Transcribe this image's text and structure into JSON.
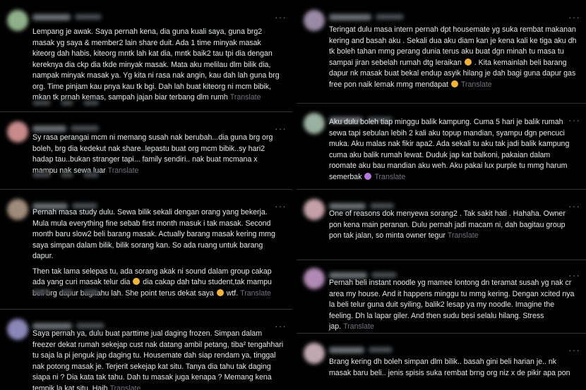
{
  "left_column": [
    {
      "avatar_color": "#8fb08a",
      "text": "Lempang je awak. Saya pernah kena, dia guna kuali saya, guna brg2 masak yg saya & member2 lain share duit. Ada 1 time minyak masak kiteorg dah habis, kiteorg mntk lah kat dia, mntk baik2 tau tpi dia dengan kereknya dia ckp dia tkde minyak masak. Mata aku melilau dlm bilik dia, nampak minyak masak ya. Yg kita ni rasa nak angin, kau dah lah guna brg org. Time pinjam kau pnya kau tk bgi. Dah lah buat kiteorg ni mcm bibik, mkan tk prnah kemas, sampah jajan biar terbang dlm rumh",
      "translate": "Translate"
    },
    {
      "avatar_color": "#c98a8a",
      "text": "Sy rasa perangai mcm ni memang susah nak berubah...dia guna brg org boleh, brg dia kedekut nak share..lepastu buat org mcm bibik..sy hari2 hadap tau..bukan stranger tapi... family sendiri.. nak buat mcmana x mampu nak sewa luar",
      "translate": "Translate"
    },
    {
      "avatar_color": "#a08a7a",
      "paragraph1": "Pernah masa study dulu. Sewa bilik sekali dengan orang yang bekerja. Mula mula everything fine sebab first month masuk i tak masak. Second month baru slow2 beli barang masak. Actually barang masak kering mmg saya simpan dalam bilik, bilik sorang kan. So ada ruang untuk barang dapur.",
      "paragraph2a": "Then tak lama selepas tu, ada sorang akak ni sound dalam group cakap ada yang curi masak telur dia",
      "paragraph2b": "dia cakap dah tahu student,tak mampu beli brg dapur bagitahu lah. She point terus dekat saya",
      "paragraph2c": "wtf.",
      "translate": "Translate"
    },
    {
      "avatar_color": "#8a86b8",
      "text": "Saya pernah ya, dulu buat parttime jual daging frozen. Simpan dalam freezer dekat rumah sekejap cust nak datang ambil petang, tiba² tengahhari tu saja la pi jenguk jap daging tu. Housemate dah siap rendam ya, tinggal nak potong masak je. Terjerit sekejap kat situ. Tanya dia tahu tak daging siapa ni ? Dia kata tak tahu. Dah tu masak juga kenapa ? Memang kena tempik la kat situ. Haih",
      "translate": "Translate"
    }
  ],
  "right_column": [
    {
      "avatar_color": "#9a8aa6",
      "text_a": "Teringat dulu masa intern pernah dpt housemate yg suka rembat makanan kering and basah aku . Sekali dua aku diam kan je kena kali ke tiga aku dh tk boleh tahan mmg perang dunia terus aku buat dgn minah tu masa tu sampai jiran sebelah rumah dtg leraikan",
      "text_b": ". Kita kemainlah beli barang dapur nk masak buat bekal endup asyik hilang je dah bagi guna dapur gas free pon naik lemak mmg mendapat",
      "translate": "Translate"
    },
    {
      "avatar_color": "#9ab0a0",
      "text": "Aku dulu boleh tiap minggu balik kampung. Cuma 5 hari je balik rumah sewa tapi sebulan lebih 2 kali aku topup mandian, syampu dgn pencuci muka. Aku malas nak fikir apa2. Ada sekali tu aku tak jadi balik kampung cuma aku balik rumah lewat. Duduk jap kat balkoni, pakaian dalam roomate aku bau mandian aku weh. Aku pakai lux purple tu mmg harum semerbak",
      "translate": "Translate"
    },
    {
      "avatar_color": "#c4a0a8",
      "text": "One of reasons dok menyewa sorang2 . Tak sakit hati . Hahaha. Owner pon kena main peranan. Dulu pernah jadi macam ni, dah bagitau group pon tak jalan, so minta owner tegur",
      "translate": "Translate"
    },
    {
      "avatar_color": "#b08ab4",
      "text": "Pernah beli instant noodle yg mamee lontong dn teramat susah yg nak cr area my house. And it happens minggu tu mmg kering. Dengan xcited nya la beli telur guna duit syiling, balik2 lesap ya my noodle. Imagine the feeling. Dh la lapar giler. And then sudu besi selalu hilang. Stress jap.",
      "translate": "Translate"
    },
    {
      "avatar_color": "#c0a8b0",
      "text": "Brang kering dh boleh simpan dlm bilik.. basah gini beli harian je.. nk masak baru beli.. jenis spisis suka rembat brng org niz x de pikir apa pon"
    }
  ]
}
